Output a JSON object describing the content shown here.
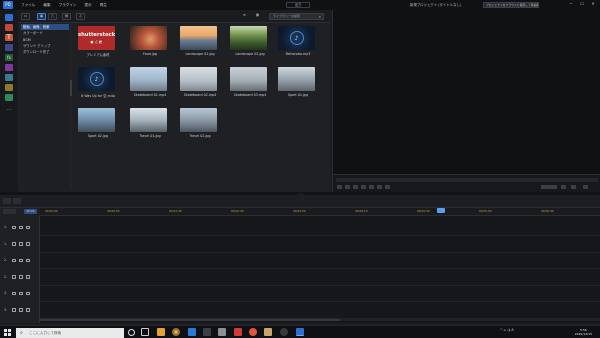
{
  "titlebar": {
    "logo": "PD",
    "menu": [
      "ファイル",
      "編集",
      "プラグイン",
      "表示",
      "再生"
    ],
    "mode_button": "出力",
    "project_title": "新規プロジェクト (タイトルなし)",
    "notification": "プロジェクトをクラウドに保存して再編集しよう！",
    "window_controls": [
      "−",
      "☐",
      "✕"
    ]
  },
  "library": {
    "search_placeholder": "ライブラリーの検索",
    "categories": [
      {
        "label": "動画、画像、音楽",
        "active": true
      },
      {
        "label": "カラーボード",
        "active": false
      },
      {
        "label": "BGM",
        "active": false
      },
      {
        "label": "サウンド クリップ",
        "active": false
      },
      {
        "label": "ダウンロード完了",
        "active": false
      }
    ],
    "items": [
      {
        "name": "プレミアム素材",
        "kind": "shutterstock",
        "brand": "shutterstock",
        "row": 0,
        "col": 0
      },
      {
        "name": "Food.jpg",
        "kind": "image",
        "palette": "food",
        "row": 0,
        "col": 1
      },
      {
        "name": "Landscape 01.jpg",
        "kind": "image",
        "palette": "land1",
        "row": 0,
        "col": 2
      },
      {
        "name": "Landscape 02.jpg",
        "kind": "image",
        "palette": "land2",
        "row": 0,
        "col": 3
      },
      {
        "name": "Mahoroba.mp3",
        "kind": "music",
        "row": 0,
        "col": 4
      },
      {
        "name": "It Was Up for 空.m4a",
        "kind": "music",
        "row": 1,
        "col": 0
      },
      {
        "name": "Skateboard 01.mp4",
        "kind": "image",
        "palette": "skate1",
        "row": 1,
        "col": 1
      },
      {
        "name": "Skateboard 02.mp4",
        "kind": "image",
        "palette": "skate2",
        "row": 1,
        "col": 2
      },
      {
        "name": "Skateboard 03.mp4",
        "kind": "image",
        "palette": "skate3",
        "row": 1,
        "col": 3
      },
      {
        "name": "Sport 01.jpg",
        "kind": "image",
        "palette": "sport1",
        "row": 1,
        "col": 4
      },
      {
        "name": "Sport 02.jpg",
        "kind": "image",
        "palette": "sport2",
        "row": 2,
        "col": 0
      },
      {
        "name": "Travel 01.jpg",
        "kind": "image",
        "palette": "travel1",
        "row": 2,
        "col": 1
      },
      {
        "name": "Travel 02.jpg",
        "kind": "image",
        "palette": "travel2",
        "row": 2,
        "col": 2
      }
    ]
  },
  "timeline": {
    "tabs": [
      "",
      "00:00"
    ],
    "ruler_ticks": [
      "00;00;00",
      "00;00;50",
      "00;01;40",
      "00;02;30",
      "00;03;20",
      "00;04;10",
      "00;05;00",
      "00;05;50",
      "00;06;40"
    ],
    "tracks": [
      "1.",
      "1.",
      "2.",
      "2.",
      "3.",
      "3."
    ]
  },
  "taskbar": {
    "search_placeholder": "ここに入力して検索",
    "tray_text": "^ ⌂ ◁) A",
    "time": "5:56",
    "date": "2020/12/15"
  },
  "colors": {
    "accent": "#3a82e0",
    "active_category": "#2b4f82",
    "ruler_text": "#c5a34a",
    "shutterstock": "#b02a2a"
  }
}
